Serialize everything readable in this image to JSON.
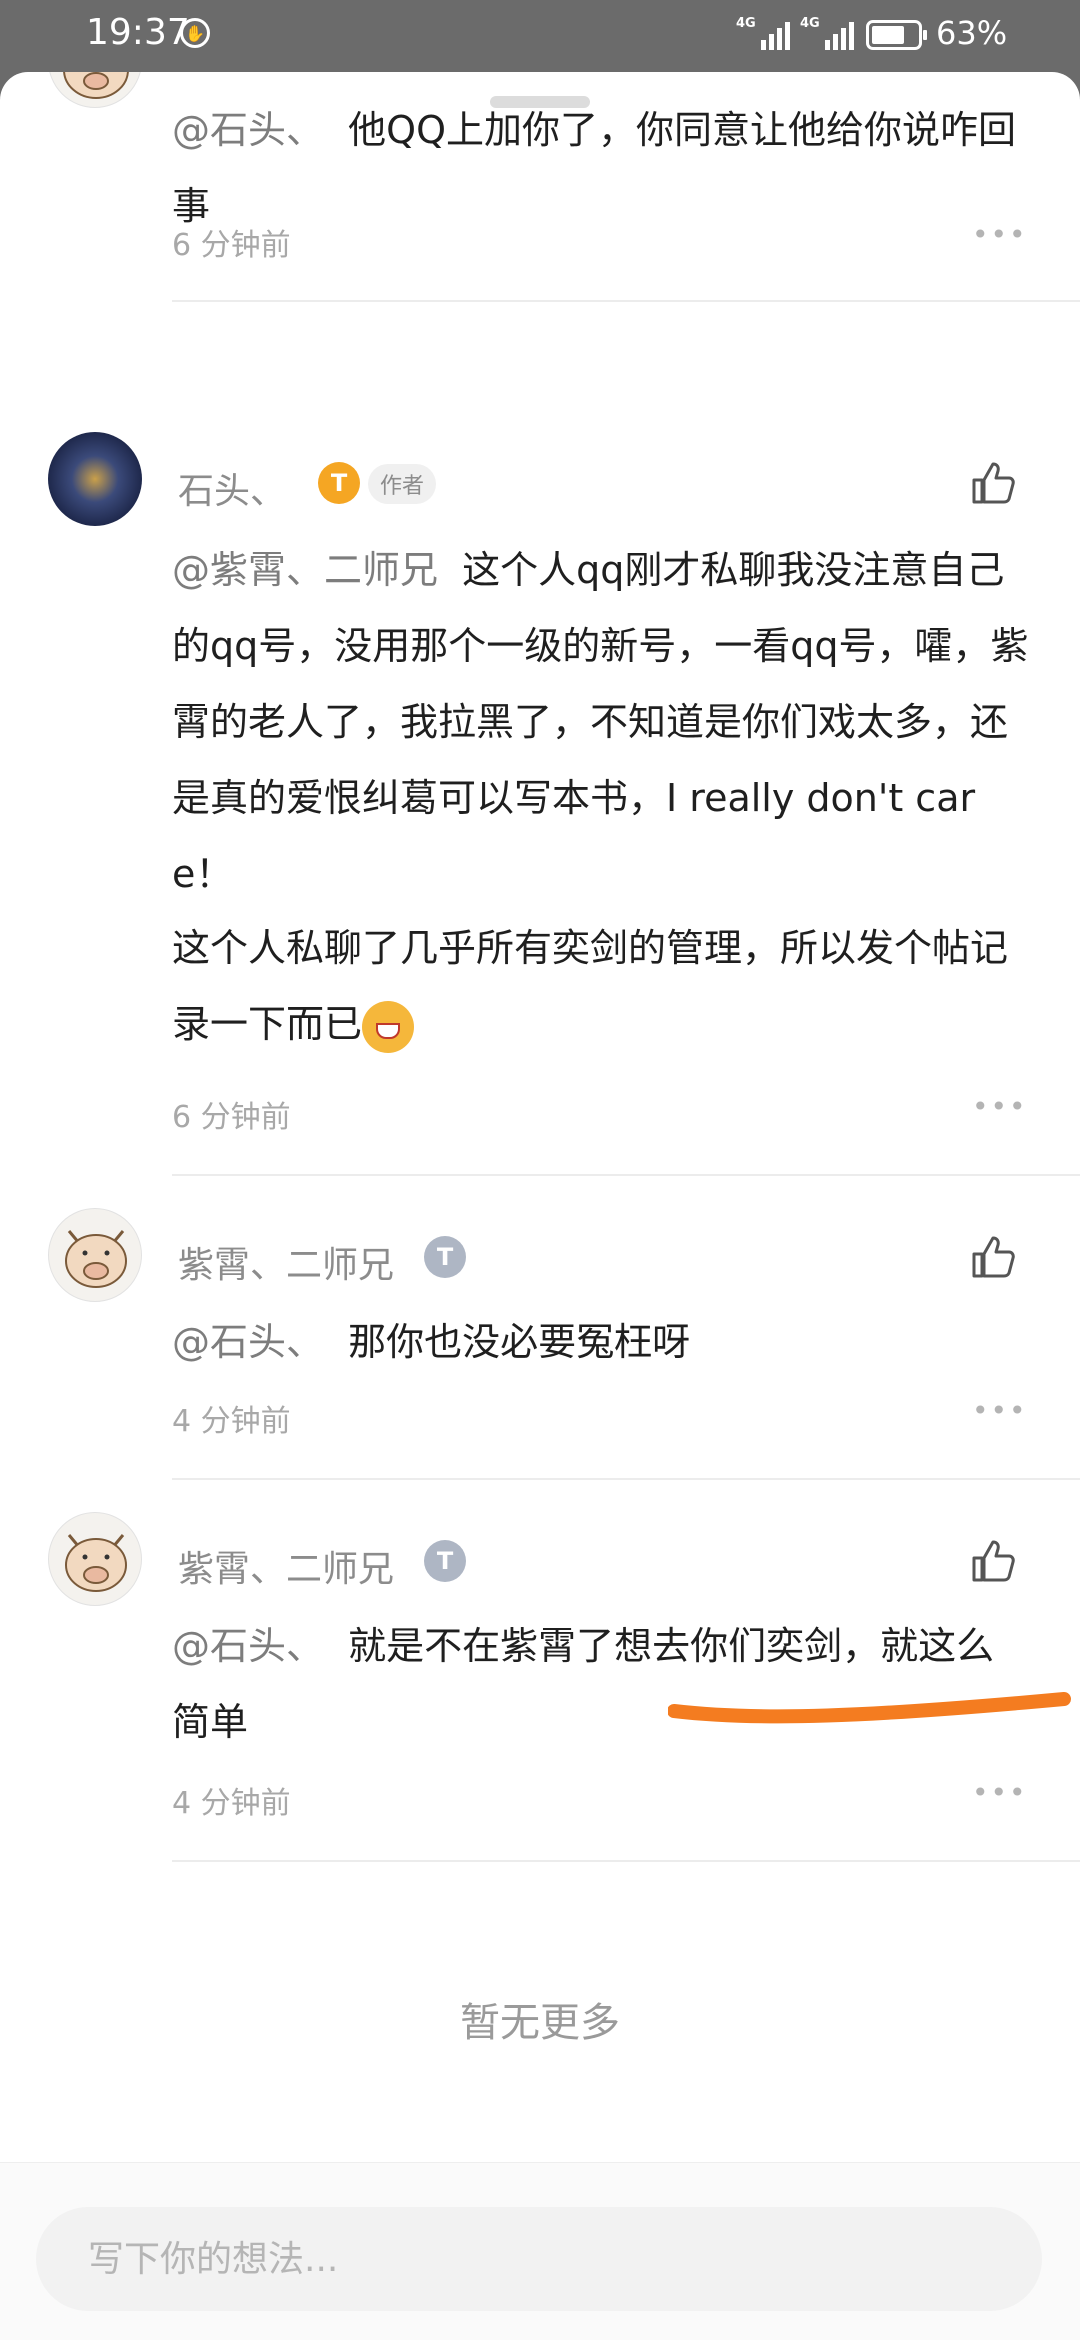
{
  "status_bar": {
    "time": "19:37",
    "network_1": "4G",
    "network_2": "4G",
    "battery": "63%"
  },
  "comments": [
    {
      "mention": "@石头、",
      "text": "  他QQ上加你了，你同意让他给你说咋回事",
      "time": "6 分钟前"
    },
    {
      "name": "石头、",
      "badge": "T",
      "author_tag": "作者",
      "mention": "@紫霄、二师兄",
      "text": "  这个人qq刚才私聊我没注意自己的qq号，没用那个一级的新号，一看qq号，嚯，紫霄的老人了，我拉黑了，不知道是你们戏太多，还是真的爱恨纠葛可以写本书，I really don't care！",
      "text2": "这个人私聊了几乎所有奕剑的管理，所以发个帖记录一下而已",
      "time": "6 分钟前"
    },
    {
      "name": "紫霄、二师兄",
      "badge": "T",
      "mention": "@石头、",
      "text": "  那你也没必要冤枉呀",
      "time": "4 分钟前"
    },
    {
      "name": "紫霄、二师兄",
      "badge": "T",
      "mention": "@石头、",
      "text": "  就是不在紫霄了想去你们奕剑，就这么简单",
      "time": "4 分钟前"
    }
  ],
  "more_symbol": "•••",
  "no_more": "暂无更多",
  "footer": {
    "placeholder": "写下你的想法..."
  },
  "colors": {
    "annotation": "#f47c20",
    "gold_badge": "#f5a623"
  }
}
